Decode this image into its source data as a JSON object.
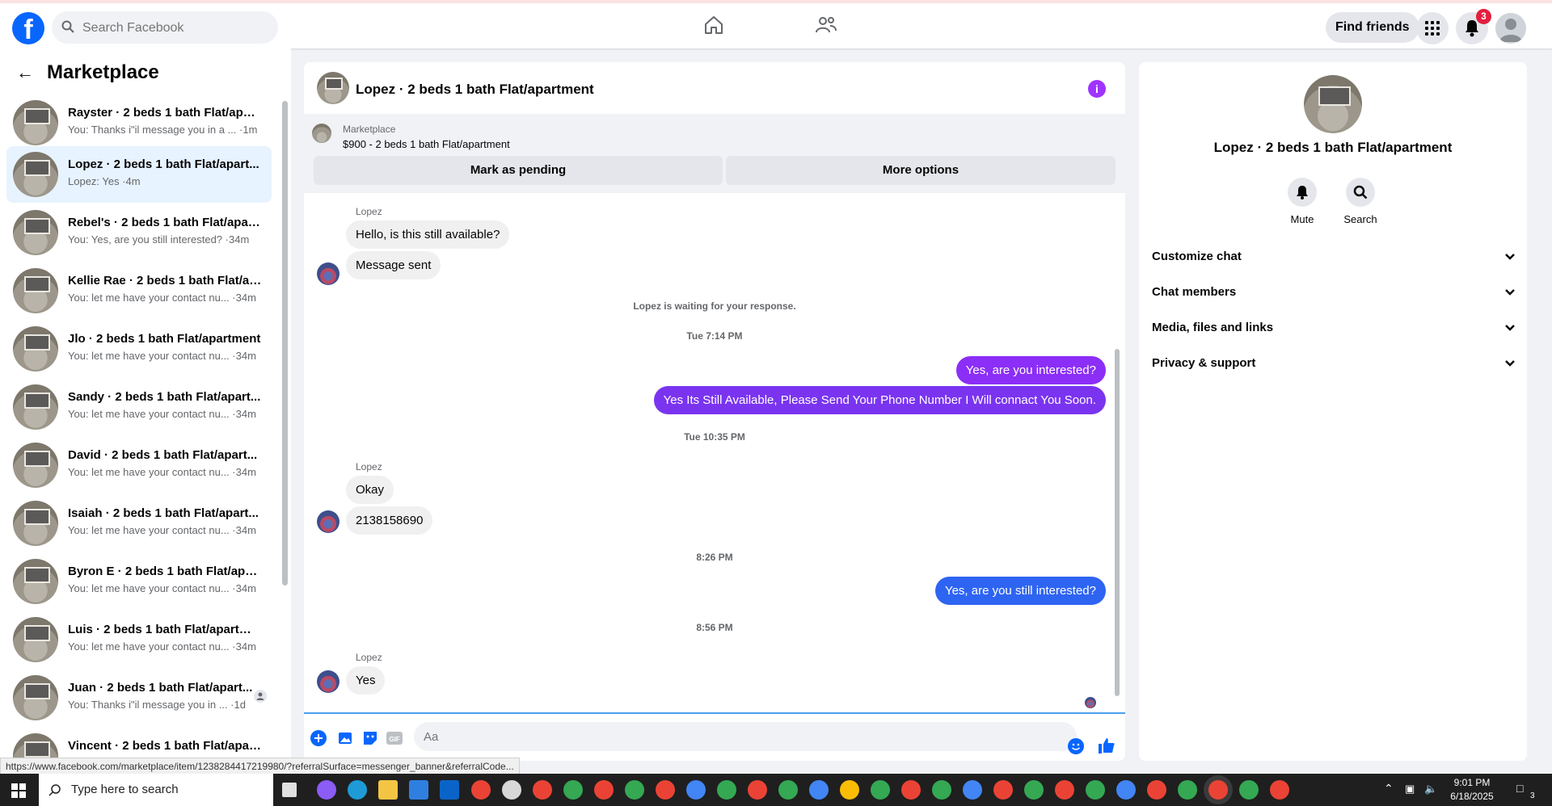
{
  "topbar": {
    "search_placeholder": "Search Facebook",
    "find_friends": "Find friends",
    "notification_count": "3",
    "icons": [
      "facebook-logo",
      "search-icon",
      "home-icon",
      "friends-icon",
      "menu-grid-icon",
      "bell-icon",
      "profile-avatar"
    ]
  },
  "sidebar": {
    "title": "Marketplace",
    "conversations": [
      {
        "title": "Rayster · 2 beds 1 bath Flat/apar...",
        "preview": "You: Thanks i\"il message you in a ... ·1m"
      },
      {
        "title": "Lopez · 2 beds 1 bath Flat/apart...",
        "preview": "Lopez: Yes ·4m"
      },
      {
        "title": "Rebel's · 2 beds 1 bath Flat/apart...",
        "preview": "You: Yes, are you still interested? ·34m"
      },
      {
        "title": "Kellie Rae · 2 beds 1 bath Flat/ap...",
        "preview": "You: let me have your contact nu... ·34m"
      },
      {
        "title": "Jlo · 2 beds 1 bath Flat/apartment",
        "preview": "You: let me have your contact nu... ·34m"
      },
      {
        "title": "Sandy · 2 beds 1 bath Flat/apart...",
        "preview": "You: let me have your contact nu... ·34m"
      },
      {
        "title": "David · 2 beds 1 bath Flat/apart...",
        "preview": "You: let me have your contact nu... ·34m"
      },
      {
        "title": "Isaiah · 2 beds 1 bath Flat/apart...",
        "preview": "You: let me have your contact nu... ·34m"
      },
      {
        "title": "Byron E · 2 beds 1 bath Flat/apar...",
        "preview": "You: let me have your contact nu... ·34m"
      },
      {
        "title": "Luis · 2 beds 1 bath Flat/apartme...",
        "preview": "You: let me have your contact nu... ·34m"
      },
      {
        "title": "Juan · 2 beds 1 bath Flat/apart...",
        "preview": "You: Thanks i\"il message you in ... ·1d"
      },
      {
        "title": "Vincent · 2 beds 1 bath Flat/apar...",
        "preview": ""
      }
    ]
  },
  "chat": {
    "title": "Lopez · 2 beds 1 bath Flat/apartment",
    "banner_label": "Marketplace",
    "banner_listing": "$900 - 2 beds 1 bath Flat/apartment",
    "mark_pending": "Mark as pending",
    "more_options": "More options",
    "waiting_note": "Lopez is waiting for your response.",
    "sender_name": "Lopez",
    "messages": {
      "m1": "Hello, is this still available?",
      "m2": "Message sent",
      "t1": "Tue 7:14 PM",
      "m3": "Yes, are you interested?",
      "m4": "Yes Its Still Available, Please Send Your Phone Number I Will connact You Soon.",
      "t2": "Tue 10:35 PM",
      "m5": "Okay",
      "m6": "2138158690",
      "t3": "8:26 PM",
      "m7": "Yes, are you still interested?",
      "t4": "8:56 PM",
      "m8": "Yes"
    },
    "composer_placeholder": "Aa",
    "colors": {
      "purple": "#a033ff",
      "blue": "#2e64f2",
      "light_bubble": "#f0f0f0"
    }
  },
  "info_panel": {
    "title": "Lopez · 2 beds 1 bath Flat/apartment",
    "mute": "Mute",
    "search": "Search",
    "sections": [
      "Customize chat",
      "Chat members",
      "Media, files and links",
      "Privacy & support"
    ]
  },
  "status_url": "https://www.facebook.com/marketplace/item/1238284417219980/?referralSurface=messenger_banner&referralCode...",
  "taskbar": {
    "search_placeholder": "Type here to search",
    "time": "9:01 PM",
    "date": "6/18/2025",
    "notification_count": "3"
  }
}
